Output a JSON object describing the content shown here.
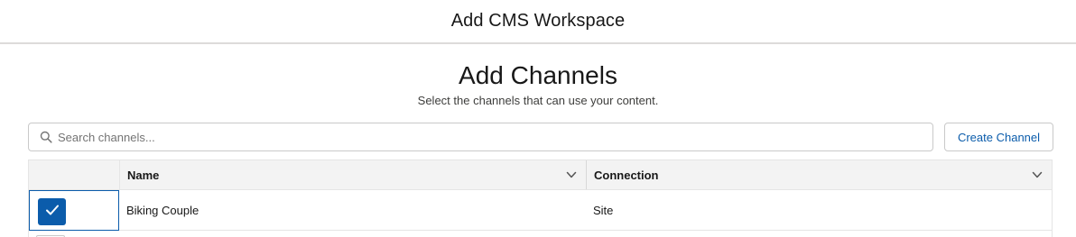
{
  "modal": {
    "title": "Add CMS Workspace"
  },
  "page": {
    "title": "Add Channels",
    "subtitle": "Select the channels that can use your content."
  },
  "search": {
    "placeholder": "Search channels...",
    "value": ""
  },
  "toolbar": {
    "create_channel_label": "Create Channel"
  },
  "table": {
    "columns": [
      {
        "label": "Name"
      },
      {
        "label": "Connection"
      }
    ],
    "rows": [
      {
        "name": "Biking Couple",
        "connection": "Site",
        "selected": true
      }
    ]
  },
  "icons": {
    "search": "search-icon",
    "sort": "chevron-down-icon",
    "check": "check-icon"
  },
  "colors": {
    "brand": "#0b5cab",
    "header_bg": "#f3f3f3",
    "border": "#c9c9c9"
  }
}
